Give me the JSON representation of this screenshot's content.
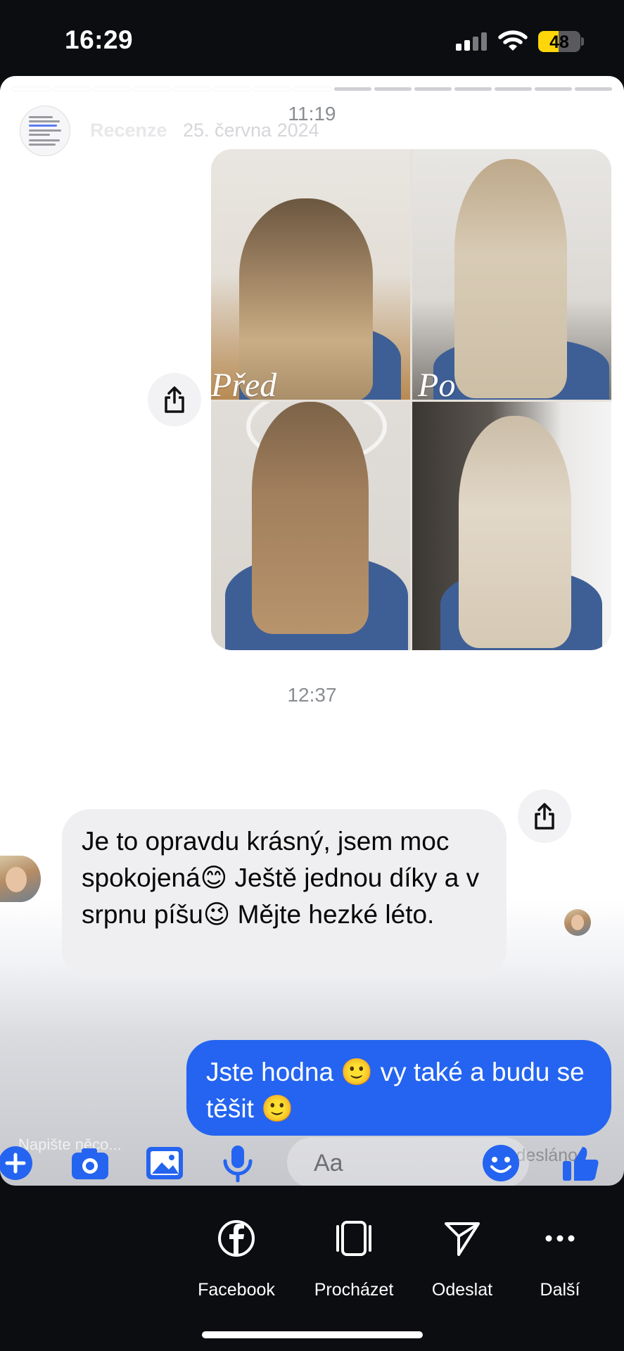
{
  "status_bar": {
    "time": "16:29",
    "battery": "48",
    "battery_percent": 48
  },
  "story": {
    "author": "Recenze",
    "date": "25. června 2024",
    "progress": {
      "total_segments": 15,
      "completed_segments": 8
    }
  },
  "conversation": {
    "timestamp_1": "11:19",
    "photo_labels": {
      "before": "Před",
      "after": "Po"
    },
    "timestamp_2": "12:37",
    "incoming_message": "Je to opravdu krásný, jsem moc spokojená😊 Ještě jednou díky a v srpnu píšu😉 Mějte hezké léto.",
    "outgoing_message": "Jste hodna 🙂 vy také a budu se těšit 🙂",
    "sent_status": "Odesláno"
  },
  "composer": {
    "hint": "Napište něco...",
    "placeholder": "Aa",
    "icons": [
      "plus-icon",
      "camera-icon",
      "image-icon",
      "microphone-icon",
      "smiley-icon",
      "thumbs-up-icon"
    ]
  },
  "share_actions": [
    {
      "label": "Facebook",
      "icon": "facebook-icon"
    },
    {
      "label": "Procházet",
      "icon": "browse-icon"
    },
    {
      "label": "Odeslat",
      "icon": "send-icon"
    },
    {
      "label": "Další",
      "icon": "more-icon"
    }
  ],
  "colors": {
    "messenger_blue": "#2464f0",
    "incoming_bubble": "#efeff1",
    "battery_yellow": "#ffd60a",
    "background": "#0b0d10"
  }
}
